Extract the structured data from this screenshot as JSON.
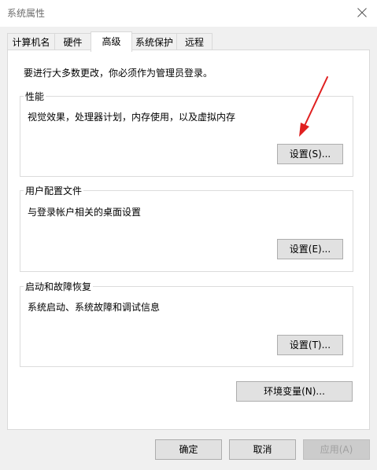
{
  "window": {
    "title": "系统属性"
  },
  "tabs": [
    {
      "label": "计算机名",
      "active": false
    },
    {
      "label": "硬件",
      "active": false
    },
    {
      "label": "高级",
      "active": true
    },
    {
      "label": "系统保护",
      "active": false
    },
    {
      "label": "远程",
      "active": false
    }
  ],
  "advanced": {
    "intro": "要进行大多数更改，你必须作为管理员登录。",
    "performance": {
      "label": "性能",
      "description": "视觉效果，处理器计划，内存使用，以及虚拟内存",
      "button": "设置(S)..."
    },
    "user_profiles": {
      "label": "用户配置文件",
      "description": "与登录帐户相关的桌面设置",
      "button": "设置(E)..."
    },
    "startup_recovery": {
      "label": "启动和故障恢复",
      "description": "系统启动、系统故障和调试信息",
      "button": "设置(T)..."
    },
    "env_button": "环境变量(N)..."
  },
  "footer": {
    "ok": "确定",
    "cancel": "取消",
    "apply": "应用(A)"
  },
  "colors": {
    "annotation_arrow": "#e02020",
    "content_bg": "#ffffff",
    "window_bg": "#f0f0f0"
  },
  "icons": {
    "close": "close-icon"
  }
}
